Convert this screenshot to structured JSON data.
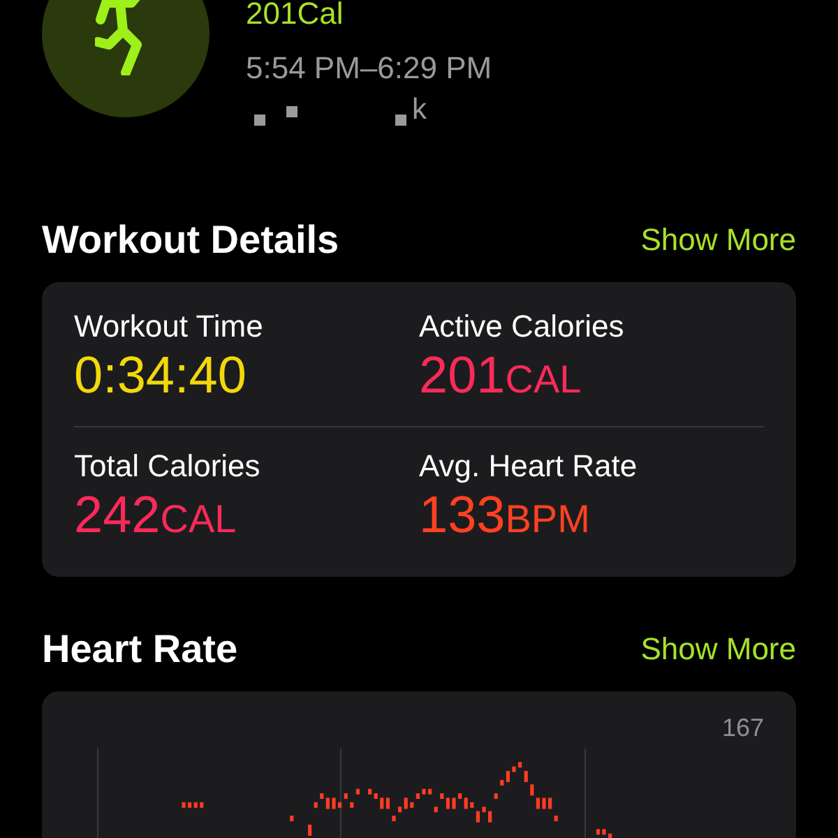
{
  "summary": {
    "calories": "201Cal",
    "time_range": "5:54 PM–6:29 PM",
    "location_fragment": "k"
  },
  "workout_details": {
    "title": "Workout Details",
    "action": "Show More",
    "metrics": [
      {
        "label": "Workout Time",
        "value": "0:34:40",
        "color": "#f2d80c"
      },
      {
        "label": "Active Calories",
        "value": "201",
        "unit": "CAL",
        "color": "#fa2a5a"
      },
      {
        "label": "Total Calories",
        "value": "242",
        "unit": "CAL",
        "color": "#fa2a5a"
      },
      {
        "label": "Avg. Heart Rate",
        "value": "133",
        "unit": "BPM",
        "color": "#ff4122"
      }
    ]
  },
  "heart_rate": {
    "title": "Heart Rate",
    "action": "Show More",
    "chart_label": "167"
  }
}
